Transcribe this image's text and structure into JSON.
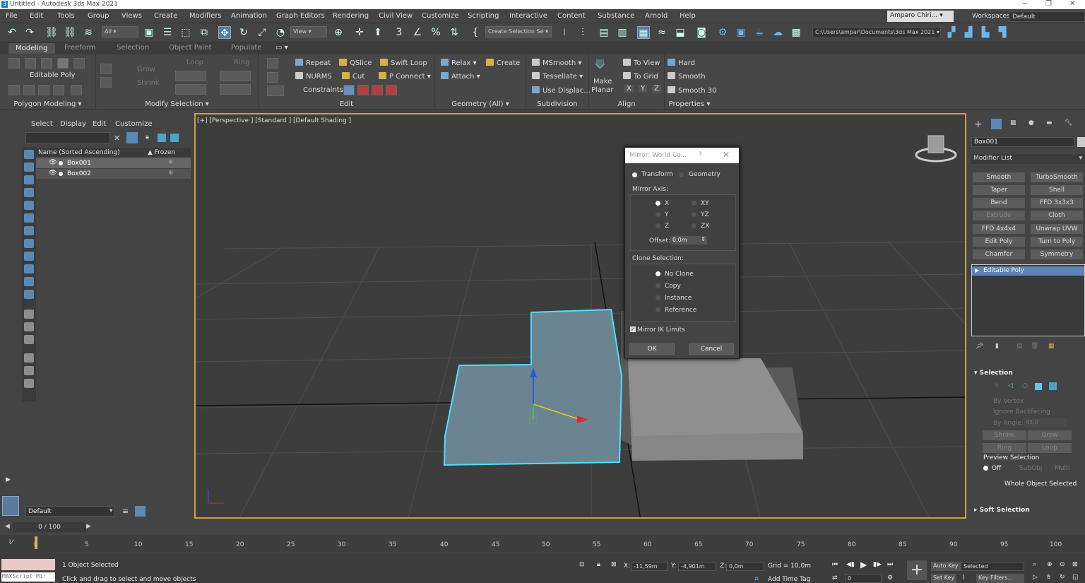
{
  "app": {
    "title": "Untitled - Autodesk 3ds Max 2021"
  },
  "menu": [
    "File",
    "Edit",
    "Tools",
    "Group",
    "Views",
    "Create",
    "Modifiers",
    "Animation",
    "Graph Editors",
    "Rendering",
    "Civil View",
    "Customize",
    "Scripting",
    "Interactive",
    "Content",
    "Substance",
    "Arnold",
    "Help"
  ],
  "user": {
    "name": "Amparo Chiri..."
  },
  "workspace": {
    "label": "Workspaces:",
    "value": "Default"
  },
  "toolbar": {
    "filter": "All",
    "view": "View",
    "selection_set": "Create Selection Se",
    "path": "C:\\Users\\ampar\\Documents\\3ds Max 2021"
  },
  "ribbon_tabs": [
    "Modeling",
    "Freeform",
    "Selection",
    "Object Paint",
    "Populate"
  ],
  "ribbon": {
    "editable_poly": "Editable Poly",
    "grow": "Grow",
    "shrink": "Shrink",
    "loop": "Loop",
    "ring": "Ring",
    "polygon_modeling": "Polygon Modeling",
    "modify_selection": "Modify Selection",
    "repeat": "Repeat",
    "qslice": "QSlice",
    "swift_loop": "Swift Loop",
    "nurms": "NURMS",
    "cut": "Cut",
    "p_connect": "P Connect",
    "constraints": "Constraints:",
    "edit": "Edit",
    "relax": "Relax",
    "create": "Create",
    "attach": "Attach",
    "geometry_all": "Geometry (All)",
    "msmooth": "MSmooth",
    "tessellate": "Tessellate",
    "use_displac": "Use Displac...",
    "subdivision": "Subdivision",
    "make_planar_1": "Make",
    "make_planar_2": "Planar",
    "to_view": "To View",
    "to_grid": "To Grid",
    "x": "X",
    "y": "Y",
    "z": "Z",
    "align": "Align",
    "hard": "Hard",
    "smooth": "Smooth",
    "smooth30": "Smooth 30",
    "properties": "Properties"
  },
  "explorer": {
    "menu": [
      "Select",
      "Display",
      "Edit",
      "Customize"
    ],
    "col_name": "Name (Sorted Ascending)",
    "col_frozen": "▲ Frozen",
    "rows": [
      {
        "name": "Box001"
      },
      {
        "name": "Box002"
      }
    ],
    "layer": "Default"
  },
  "viewport": {
    "label": "[+] [Perspective ] [Standard ] [Default Shading ]"
  },
  "dialog": {
    "title": "Mirror: World Co...",
    "transform": "Transform",
    "geometry": "Geometry",
    "mirror_axis": "Mirror Axis:",
    "axes": [
      "X",
      "Y",
      "Z",
      "XY",
      "YZ",
      "ZX"
    ],
    "offset_label": "Offset:",
    "offset_value": "0,0m",
    "clone_selection": "Clone Selection:",
    "clone_options": [
      "No Clone",
      "Copy",
      "Instance",
      "Reference"
    ],
    "mirror_ik": "Mirror IK Limits",
    "ok": "OK",
    "cancel": "Cancel"
  },
  "command_panel": {
    "object_name": "Box001",
    "modifier_list": "Modifier List",
    "modifiers": [
      "Smooth",
      "TurboSmooth",
      "Taper",
      "Shell",
      "Bend",
      "FFD 3x3x3",
      "Extrude",
      "Cloth",
      "FFD 4x4x4",
      "Unwrap UVW",
      "Edit Poly",
      "Turn to Poly",
      "Chamfer",
      "Symmetry"
    ],
    "stack_item": "Editable Poly",
    "selection": "Selection",
    "by_vertex": "By Vertex",
    "ignore_backfacing": "Ignore Backfacing",
    "by_angle": "By Angle:",
    "by_angle_value": "45,0",
    "shrink": "Shrink",
    "grow": "Grow",
    "ring": "Ring",
    "loop": "Loop",
    "preview_selection": "Preview Selection",
    "off": "Off",
    "subobj": "SubObj",
    "multi": "Multi",
    "whole_object": "Whole Object Selected",
    "soft_selection": "Soft Selection"
  },
  "timeline": {
    "frame": "0 / 100",
    "ticks": [
      "0",
      "5",
      "10",
      "15",
      "20",
      "25",
      "30",
      "35",
      "40",
      "45",
      "50",
      "55",
      "60",
      "65",
      "70",
      "75",
      "80",
      "85",
      "90",
      "95",
      "100"
    ]
  },
  "status": {
    "maxscript": "MAXScript Mi:",
    "objects_selected": "1 Object Selected",
    "prompt": "Click and drag to select and move objects",
    "x": "-11,59m",
    "y": "-4,901m",
    "z": "0,0m",
    "grid": "Grid = 10,0m",
    "add_time_tag": "Add Time Tag",
    "auto_key": "Auto Key",
    "set_key": "Set Key",
    "selected": "Selected",
    "key_filters": "Key Filters...",
    "frame_value": "0"
  }
}
